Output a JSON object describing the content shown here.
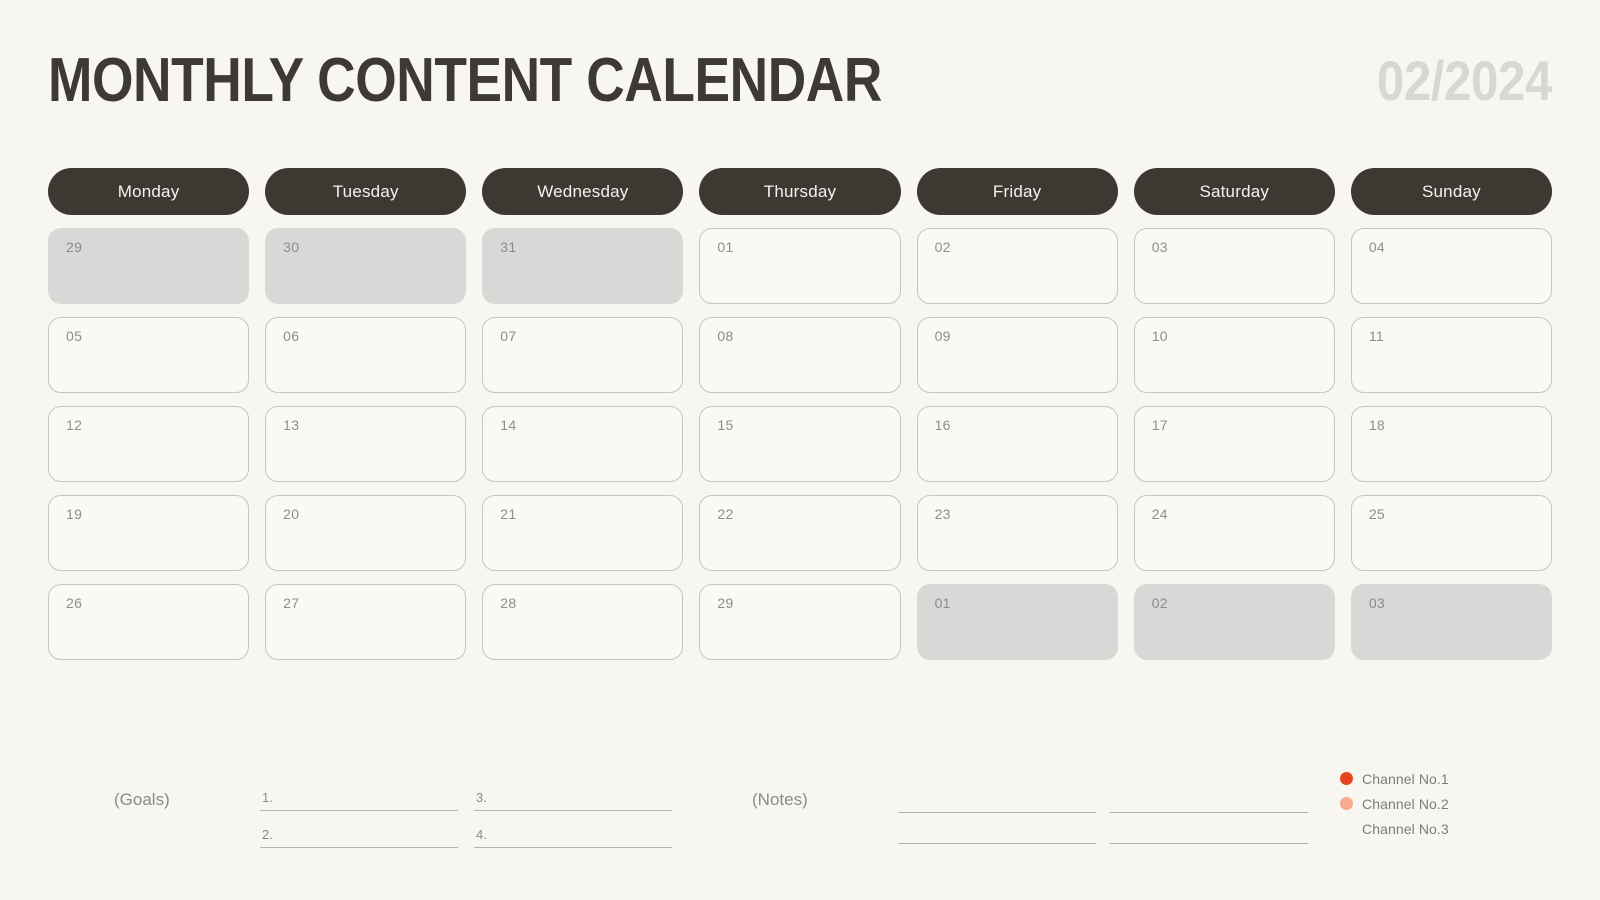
{
  "header": {
    "title": "MONTHLY CONTENT CALENDAR",
    "period": "02/2024"
  },
  "calendar": {
    "day_names": [
      "Monday",
      "Tuesday",
      "Wednesday",
      "Thursday",
      "Friday",
      "Saturday",
      "Sunday"
    ],
    "weeks": [
      [
        {
          "num": "29",
          "muted": true
        },
        {
          "num": "30",
          "muted": true
        },
        {
          "num": "31",
          "muted": true
        },
        {
          "num": "01",
          "muted": false
        },
        {
          "num": "02",
          "muted": false
        },
        {
          "num": "03",
          "muted": false
        },
        {
          "num": "04",
          "muted": false
        }
      ],
      [
        {
          "num": "05",
          "muted": false
        },
        {
          "num": "06",
          "muted": false
        },
        {
          "num": "07",
          "muted": false
        },
        {
          "num": "08",
          "muted": false
        },
        {
          "num": "09",
          "muted": false
        },
        {
          "num": "10",
          "muted": false
        },
        {
          "num": "11",
          "muted": false
        }
      ],
      [
        {
          "num": "12",
          "muted": false
        },
        {
          "num": "13",
          "muted": false
        },
        {
          "num": "14",
          "muted": false
        },
        {
          "num": "15",
          "muted": false
        },
        {
          "num": "16",
          "muted": false
        },
        {
          "num": "17",
          "muted": false
        },
        {
          "num": "18",
          "muted": false
        }
      ],
      [
        {
          "num": "19",
          "muted": false
        },
        {
          "num": "20",
          "muted": false
        },
        {
          "num": "21",
          "muted": false
        },
        {
          "num": "22",
          "muted": false
        },
        {
          "num": "23",
          "muted": false
        },
        {
          "num": "24",
          "muted": false
        },
        {
          "num": "25",
          "muted": false
        }
      ],
      [
        {
          "num": "26",
          "muted": false
        },
        {
          "num": "27",
          "muted": false
        },
        {
          "num": "28",
          "muted": false
        },
        {
          "num": "29",
          "muted": false
        },
        {
          "num": "01",
          "muted": true
        },
        {
          "num": "02",
          "muted": true
        },
        {
          "num": "03",
          "muted": true
        }
      ]
    ]
  },
  "footer": {
    "goals_label": "(Goals)",
    "notes_label": "(Notes)",
    "goals_columns": [
      [
        {
          "idx": "1."
        },
        {
          "idx": "2."
        }
      ],
      [
        {
          "idx": "3."
        },
        {
          "idx": "4."
        }
      ]
    ],
    "notes_columns": [
      [
        {
          "idx": ""
        },
        {
          "idx": ""
        }
      ],
      [
        {
          "idx": ""
        },
        {
          "idx": ""
        }
      ]
    ],
    "legend": [
      {
        "label": "Channel No.1",
        "color": "#e8441f"
      },
      {
        "label": "Channel No.2",
        "color": "#f6a98c"
      },
      {
        "label": "Channel No.3",
        "color": "#aec martial"
      }
    ]
  },
  "colors": {
    "background": "#f7f6f0",
    "ink": "#3d3933",
    "pill": "#3d3832",
    "muted_cell": "#d8d8d6",
    "cell_border": "#c9c5bd",
    "period_gray": "#d8d7d2"
  }
}
